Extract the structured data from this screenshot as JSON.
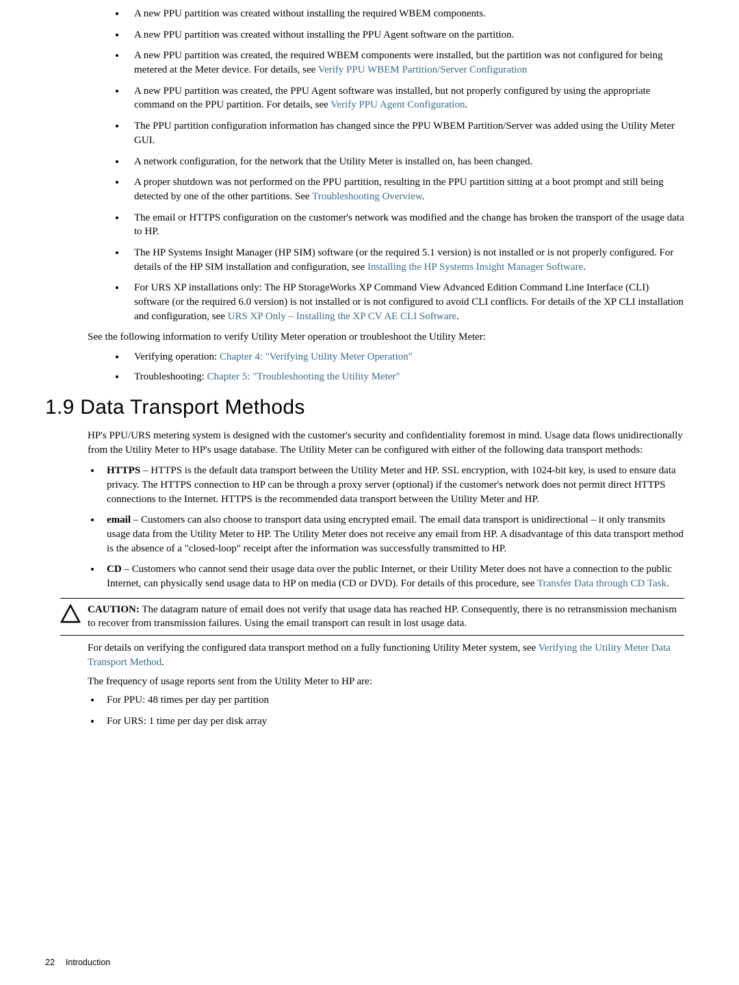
{
  "bullets": {
    "b1": "A new PPU partition was created without installing the required WBEM components.",
    "b2": "A new PPU partition was created without installing the PPU Agent software on the partition.",
    "b3_a": "A new PPU partition was created, the required WBEM components were installed, but the partition was not configured for being metered at the Meter device. For details, see ",
    "b3_link": "Verify PPU WBEM Partition/Server Configuration",
    "b4_a": "A new PPU partition was created, the PPU Agent software was installed, but not properly configured by using the appropriate command on the PPU partition. For details, see ",
    "b4_link": "Verify PPU Agent Configuration",
    "b4_c": ".",
    "b5": "The PPU partition configuration information has changed since the PPU WBEM Partition/Server was added using the Utility Meter GUI.",
    "b6": "A network configuration, for the network that the Utility Meter is installed on, has been changed.",
    "b7_a": "A proper shutdown was not performed on the PPU partition, resulting in the PPU partition sitting at a boot prompt and still being detected by one of the other partitions. See ",
    "b7_link": "Troubleshooting Overview",
    "b7_c": ".",
    "b8": "The email or HTTPS configuration on the customer's network was modified and the change has broken the transport of the usage data to HP.",
    "b9_a": "The HP Systems Insight Manager (HP SIM) software (or the required 5.1 version) is not installed or is not properly configured. For details of the HP SIM installation and configuration, see ",
    "b9_link": "Installing the HP Systems Insight Manager Software",
    "b9_c": ".",
    "b10_a": "For URS XP installations only: The HP StorageWorks XP Command View Advanced Edition Command Line Interface (CLI) software (or the required 6.0 version) is not installed or is not configured to avoid CLI conflicts. For details of the XP CLI installation and configuration, see ",
    "b10_link": "URS XP Only – Installing the XP CV AE CLI Software",
    "b10_c": "."
  },
  "intro": "See the following information to verify Utility Meter operation or troubleshoot the Utility Meter:",
  "sub": {
    "s1_a": "Verifying operation: ",
    "s1_link": "Chapter 4: \"Verifying Utility Meter Operation\"",
    "s2_a": "Troubleshooting: ",
    "s2_link": "Chapter 5: \"Troubleshooting the Utility Meter\""
  },
  "section": {
    "heading": "1.9 Data Transport Methods",
    "body": "HP's PPU/URS metering system is designed with the customer's security and confidentiality foremost in mind. Usage data flows unidirectionally from the Utility Meter to HP's usage database. The Utility Meter can be configured with either of the following data transport methods:",
    "https_label": "HTTPS",
    "https_text": " – HTTPS is the default data transport between the Utility Meter and HP. SSL encryption, with 1024-bit key, is used to ensure data privacy. The HTTPS connection to HP can be through a proxy server (optional) if the customer's network does not permit direct HTTPS connections to the Internet. HTTPS is the recommended data transport between the Utility Meter and HP.",
    "email_label": "email",
    "email_text": " – Customers can also choose to transport data using encrypted email. The email data transport is unidirectional – it only transmits usage data from the Utility Meter to HP. The Utility Meter does not receive any email from HP. A disadvantage of this data transport method is the absence of a \"closed-loop\" receipt after the information was successfully transmitted to HP.",
    "cd_label": "CD",
    "cd_text_a": " – Customers who cannot send their usage data over the public Internet, or their Utility Meter does not have a connection to the public Internet, can physically send usage data to HP on media (CD or DVD). For details of this procedure, see ",
    "cd_link": "Transfer Data through CD Task",
    "cd_text_c": "."
  },
  "caution": {
    "label": "CAUTION:",
    "text": "   The datagram nature of email does not verify that usage data has reached HP. Consequently, there is no retransmission mechanism to recover from transmission failures. Using the email transport can result in lost usage data."
  },
  "after": {
    "p1_a": "For details on verifying the configured data transport method on a fully functioning Utility Meter system, see ",
    "p1_link": "Verifying the Utility Meter Data Transport Method",
    "p1_c": ".",
    "p2": "The frequency of usage reports sent from the Utility Meter to HP are:",
    "f1": "For PPU: 48 times per day per partition",
    "f2": "For URS: 1 time per day per disk array"
  },
  "footer": {
    "page": "22",
    "label": "Introduction"
  }
}
